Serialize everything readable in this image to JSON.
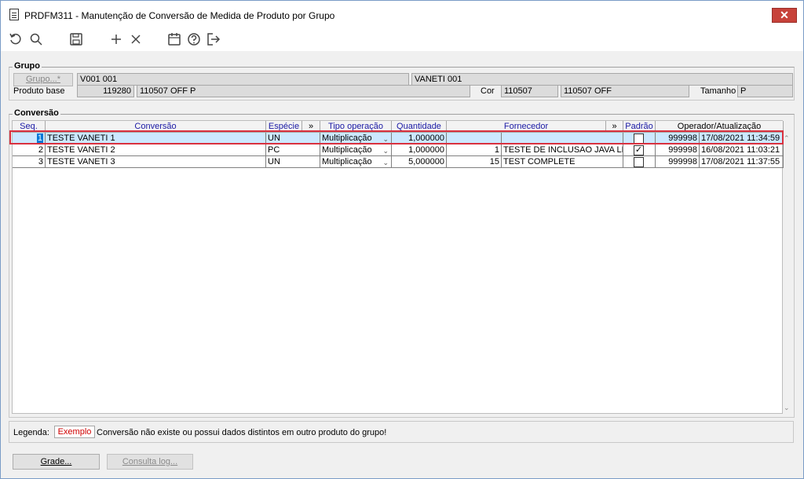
{
  "window": {
    "title": "PRDFM311 - Manutenção de Conversão de Medida de Produto por Grupo",
    "close_label": "✕"
  },
  "toolbar": {
    "icons": [
      "refresh-icon",
      "search-icon",
      "save-icon",
      "add-icon",
      "delete-icon",
      "calendar-icon",
      "help-icon",
      "exit-icon"
    ]
  },
  "grupo": {
    "section_title": "Grupo",
    "grupo_button": "Grupo...*",
    "grupo_code": "V001 001",
    "grupo_desc": "VANETI 001",
    "produto_label": "Produto base",
    "produto_code": "119280",
    "produto_desc": "110507 OFF P",
    "cor_label": "Cor",
    "cor_code": "110507",
    "cor_desc": "110507 OFF",
    "tamanho_label": "Tamanho",
    "tamanho_value": "P"
  },
  "conversao": {
    "section_title": "Conversão",
    "headers": {
      "seq": "Seq.",
      "conversao": "Conversão",
      "especie": "Espécie",
      "more1": "»",
      "tipo": "Tipo operação",
      "quantidade": "Quantidade",
      "fornecedor": "Fornecedor",
      "more2": "»",
      "padrao": "Padrão",
      "operador": "Operador/Atualização"
    },
    "rows": [
      {
        "seq": "1",
        "conversao": "TESTE VANETI 1",
        "especie": "UN",
        "tipo": "Multiplicação",
        "quantidade": "1,000000",
        "forn_code": "",
        "forn_name": "",
        "padrao": "",
        "operador": "999998",
        "data": "17/08/2021 11:34:59"
      },
      {
        "seq": "2",
        "conversao": "TESTE VANETI 2",
        "especie": "PC",
        "tipo": "Multiplicação",
        "quantidade": "1,000000",
        "forn_code": "1",
        "forn_name": "TESTE DE INCLUSAO JAVA LEO",
        "padrao": "✓",
        "operador": "999998",
        "data": "16/08/2021 11:03:21"
      },
      {
        "seq": "3",
        "conversao": "TESTE VANETI 3",
        "especie": "UN",
        "tipo": "Multiplicação",
        "quantidade": "5,000000",
        "forn_code": "15",
        "forn_name": "TEST COMPLETE",
        "padrao": "",
        "operador": "999998",
        "data": "17/08/2021 11:37:55"
      }
    ]
  },
  "legenda": {
    "label": "Legenda:",
    "exemplo": "Exemplo",
    "text": "Conversão não existe ou possui dados distintos em outro produto do grupo!"
  },
  "footer": {
    "grade_button": "Grade...",
    "log_button": "Consulta log..."
  },
  "colors": {
    "selection": "#cce8ff",
    "highlight_outline": "#d9313f",
    "header_text": "#1a1aa6",
    "close_button": "#c7423a"
  }
}
